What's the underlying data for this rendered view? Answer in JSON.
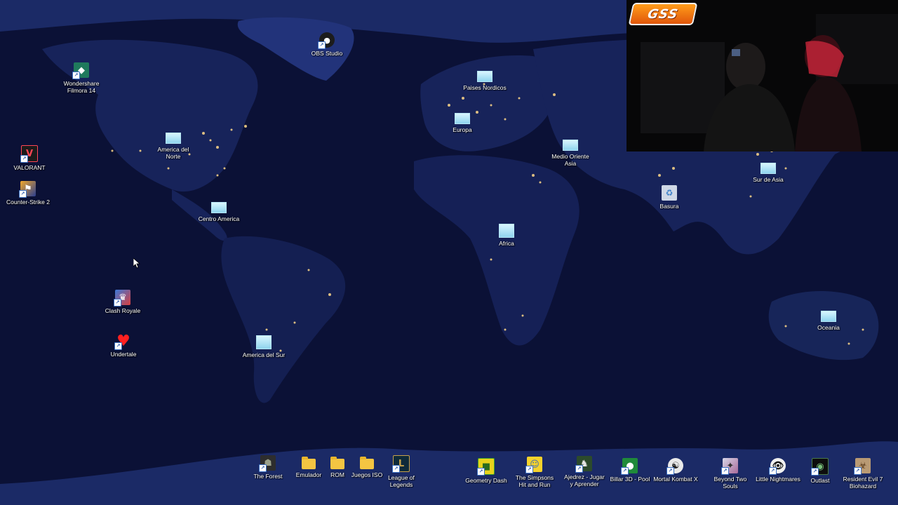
{
  "desktop": {
    "icons": {
      "obs": {
        "label": "OBS Studio",
        "icon": "obs-icon"
      },
      "filmora": {
        "label": "Wondershare Filmora 14",
        "icon": "filmora-icon"
      },
      "valorant": {
        "label": "VALORANT",
        "icon": "valorant-icon"
      },
      "cs2": {
        "label": "Counter-Strike 2",
        "icon": "counter-strike-icon"
      },
      "clash": {
        "label": "Clash Royale",
        "icon": "clash-royale-icon"
      },
      "undertale": {
        "label": "Undertale",
        "icon": "heart-icon"
      },
      "paises_nordicos": {
        "label": "Paises Nordicos",
        "icon": "region-shortcut-icon"
      },
      "europa": {
        "label": "Europa",
        "icon": "region-shortcut-icon"
      },
      "medio_oriente": {
        "label": "Medio Oriente Asia",
        "icon": "region-shortcut-icon"
      },
      "sur_de_asia": {
        "label": "Sur de Asia",
        "icon": "region-shortcut-icon"
      },
      "basura": {
        "label": "Basura",
        "icon": "recycle-bin-icon"
      },
      "america_norte": {
        "label": "America del Norte",
        "icon": "region-shortcut-icon"
      },
      "centro_america": {
        "label": "Centro America",
        "icon": "region-shortcut-icon"
      },
      "africa": {
        "label": "Africa",
        "icon": "region-shortcut-icon"
      },
      "america_sur": {
        "label": "America del Sur",
        "icon": "region-shortcut-icon"
      },
      "oceania": {
        "label": "Oceania",
        "icon": "region-shortcut-icon"
      },
      "the_forest": {
        "label": "The Forest",
        "icon": "the-forest-icon"
      },
      "emulador": {
        "label": "Emulador",
        "icon": "folder-icon"
      },
      "rom": {
        "label": "ROM",
        "icon": "folder-icon"
      },
      "juegos_iso": {
        "label": "Juegos ISO",
        "icon": "folder-icon"
      },
      "lol": {
        "label": "League of Legends",
        "icon": "league-of-legends-icon"
      },
      "geometry_dash": {
        "label": "Geometry Dash",
        "icon": "geometry-dash-icon"
      },
      "simpsons": {
        "label": "The Simpsons Hit and Run",
        "icon": "simpsons-icon"
      },
      "ajedrez": {
        "label": "Ajedrez - Jugar y Aprender",
        "icon": "chess-icon"
      },
      "billar": {
        "label": "Billar 3D - Pool",
        "icon": "pool-icon"
      },
      "mortal_kombat": {
        "label": "Mortal Kombat X",
        "icon": "mortal-kombat-icon"
      },
      "beyond": {
        "label": "Beyond Two Souls",
        "icon": "beyond-two-souls-icon"
      },
      "little_nightmares": {
        "label": "Little Nightmares",
        "icon": "little-nightmares-icon"
      },
      "outlast": {
        "label": "Outlast",
        "icon": "outlast-icon"
      },
      "re7": {
        "label": "Resident Evil 7 Biohazard",
        "icon": "resident-evil-icon"
      }
    }
  },
  "webcam": {
    "logo_text": "GSS"
  },
  "colors": {
    "ocean": "#0b1136",
    "land": "#1a2b63",
    "city_lights": "#ffd98a",
    "ice": "#2a3c7e"
  }
}
